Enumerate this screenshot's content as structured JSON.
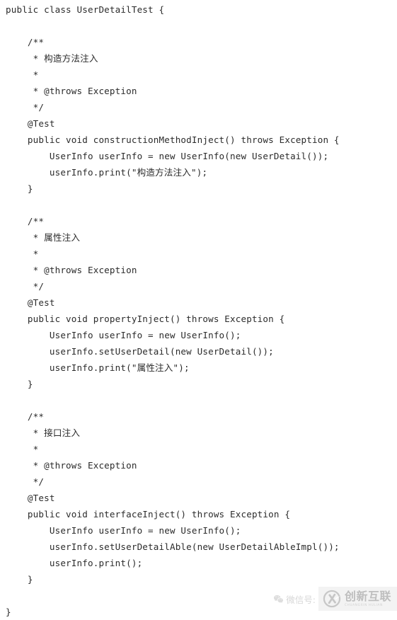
{
  "document": {
    "language": "java",
    "background_color": "#ffffff",
    "text_color": "#2b2b2b",
    "lines": [
      "public class UserDetailTest {",
      "",
      "    /**",
      "     * 构造方法注入",
      "     *",
      "     * @throws Exception",
      "     */",
      "    @Test",
      "    public void constructionMethodInject() throws Exception {",
      "        UserInfo userInfo = new UserInfo(new UserDetail());",
      "        userInfo.print(\"构造方法注入\");",
      "    }",
      "",
      "    /**",
      "     * 属性注入",
      "     *",
      "     * @throws Exception",
      "     */",
      "    @Test",
      "    public void propertyInject() throws Exception {",
      "        UserInfo userInfo = new UserInfo();",
      "        userInfo.setUserDetail(new UserDetail());",
      "        userInfo.print(\"属性注入\");",
      "    }",
      "",
      "    /**",
      "     * 接口注入",
      "     *",
      "     * @throws Exception",
      "     */",
      "    @Test",
      "    public void interfaceInject() throws Exception {",
      "        UserInfo userInfo = new UserInfo();",
      "        userInfo.setUserDetailAble(new UserDetailAbleImpl());",
      "        userInfo.print();",
      "    }",
      "",
      "}"
    ]
  },
  "watermark": {
    "wechat_label": "微信号:",
    "wechat_icon": "wechat-icon",
    "logo_mark_icon": "chuangxin-circle-x-logo",
    "logo_title": "创新互联",
    "logo_subtitle": "CHUANGXIN HULIAN"
  }
}
